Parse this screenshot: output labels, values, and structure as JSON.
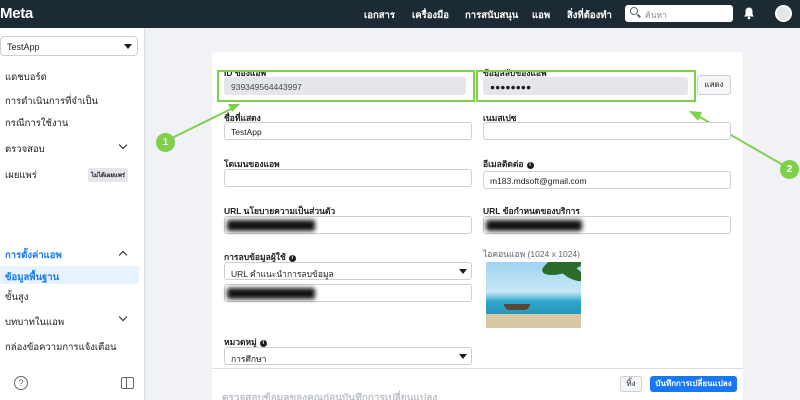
{
  "topbar": {
    "logo": "Meta",
    "nav": [
      "เอกสาร",
      "เครื่องมือ",
      "การสนับสนุน",
      "แอพ",
      "สิ่งที่ต้องทำ"
    ],
    "search_placeholder": "ค้นหา"
  },
  "sidebar": {
    "app_name": "TestApp",
    "items": {
      "dashboard": "แดชบอร์ด",
      "required_actions": "การดำเนินการที่จำเป็น",
      "use_cases": "กรณีการใช้งาน",
      "review": "ตรวจสอบ",
      "publish": "เผยแพร่",
      "publish_badge": "ไม่ได้เผยแพร่",
      "app_settings": "การตั้งค่าแอพ",
      "basic": "ข้อมูลพื้นฐาน",
      "advanced": "ขั้นสูง",
      "app_roles": "บทบาทในแอพ",
      "alerts_inbox": "กล่องข้อความการแจ้งเตือน"
    },
    "help_icon_text": "?"
  },
  "form": {
    "app_id_label": "ID ของแอพ",
    "app_id_value": "939349564443997",
    "app_secret_label": "ข้อมูลลับของแอพ",
    "app_secret_value": "●●●●●●●●",
    "show_button": "แสดง",
    "display_name_label": "ชื่อที่แสดง",
    "display_name_value": "TestApp",
    "namespace_label": "เนมสเปซ",
    "app_domains_label": "โดเมนของแอพ",
    "contact_email_label": "อีเมลติดต่อ",
    "contact_email_value": "m183.mdsoft@gmail.com",
    "privacy_url_label": "URL นโยบายความเป็นส่วนตัว",
    "tos_url_label": "URL ข้อกำหนดของบริการ",
    "data_deletion_label": "การลบข้อมูลผู้ใช้",
    "data_deletion_select": "URL คำแนะนำการลบข้อมูล",
    "app_icon_label": "ไอคอนแอพ (1024 x 1024)",
    "category_label": "หมวดหมู่",
    "category_value": "การศึกษา"
  },
  "markers": [
    "1",
    "2"
  ],
  "actions": {
    "cancel": "ทิ้ง",
    "save": "บันทึกการเปลี่ยนแปลง"
  },
  "footer_text": "ตรวจสอบข้อมูลของคุณก่อนบันทึกการเปลี่ยนแปลง",
  "colors": {
    "topbar": "#1c2b33",
    "accent": "#1877f2",
    "highlight": "#7ed04b"
  }
}
